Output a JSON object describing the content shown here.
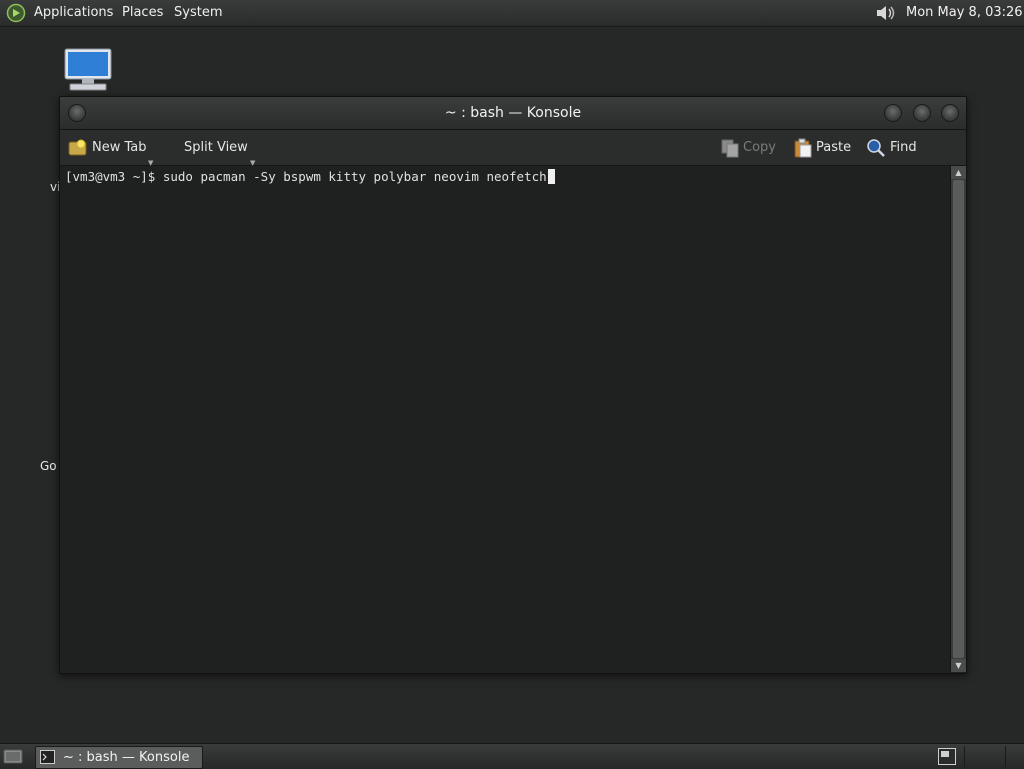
{
  "top_panel": {
    "menus": [
      "Applications",
      "Places",
      "System"
    ],
    "clock": "Mon May  8, 03:26"
  },
  "desktop": {
    "partial_labels": [
      "vi",
      "Go"
    ]
  },
  "window": {
    "title": "~ : bash — Konsole",
    "toolbar": {
      "new_tab": "New Tab",
      "split_view": "Split View",
      "copy": "Copy",
      "paste": "Paste",
      "find": "Find"
    },
    "terminal": {
      "prompt": "[vm3@vm3 ~]$ ",
      "command": "sudo pacman -Sy bspwm kitty polybar neovim neofetch"
    }
  },
  "taskbar": {
    "task_label": "~ : bash — Konsole"
  },
  "colors": {
    "desktop_bg": "#262827",
    "terminal_bg": "#1e2120",
    "accent_green": "#5a8a3a"
  }
}
